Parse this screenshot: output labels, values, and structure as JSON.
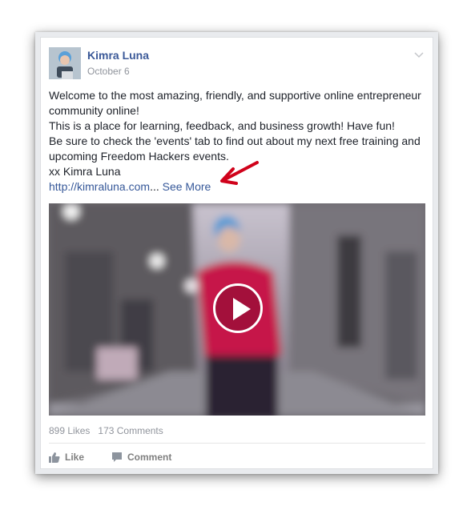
{
  "post": {
    "author": "Kimra Luna",
    "date": "October 6",
    "lines": [
      "Welcome to the most amazing, friendly, and supportive online entrepreneur",
      "community online!",
      "This is a place for learning, feedback, and business growth! Have fun!",
      "Be sure to check the 'events' tab to find out about my next free training and",
      "upcoming Freedom Hackers events.",
      "xx Kimra Luna"
    ],
    "link_text": "http://kimraluna.com",
    "ellipsis": "...",
    "see_more": "See More"
  },
  "stats": {
    "likes": "899 Likes",
    "comments": "173 Comments"
  },
  "actions": {
    "like": "Like",
    "comment": "Comment"
  },
  "colors": {
    "link": "#365899",
    "author": "#3b5998",
    "meta": "#90949c",
    "annotation_arrow": "#d0021b"
  },
  "icons": {
    "menu": "chevron-down-icon",
    "play": "play-icon",
    "like": "thumbs-up-icon",
    "comment": "comment-bubble-icon",
    "annotation": "red-arrow-icon"
  }
}
